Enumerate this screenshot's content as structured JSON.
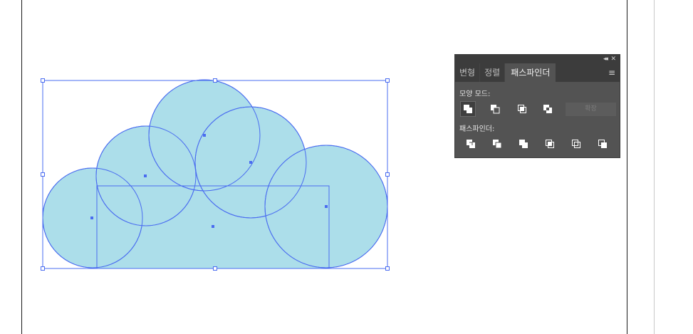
{
  "panel": {
    "tabs": [
      "변형",
      "정렬",
      "패스파인더"
    ],
    "active_tab": "패스파인더",
    "collapse_symbol": "◂◂",
    "close_symbol": "✕",
    "menu_symbol": "≡",
    "shape_modes_label": "모양 모드:",
    "expand_label": "확장",
    "pathfinders_label": "패스파인더:",
    "shape_mode_icons": [
      "unite-icon",
      "minus-front-icon",
      "intersect-icon",
      "exclude-icon"
    ],
    "pathfinder_icons": [
      "divide-icon",
      "trim-icon",
      "merge-icon",
      "crop-icon",
      "outline-icon",
      "minus-back-icon"
    ]
  },
  "colors": {
    "shape_fill": "#acdeea",
    "selection": "#4a6cf0",
    "panel_bg": "#535353",
    "panel_header": "#3c3c3c"
  }
}
